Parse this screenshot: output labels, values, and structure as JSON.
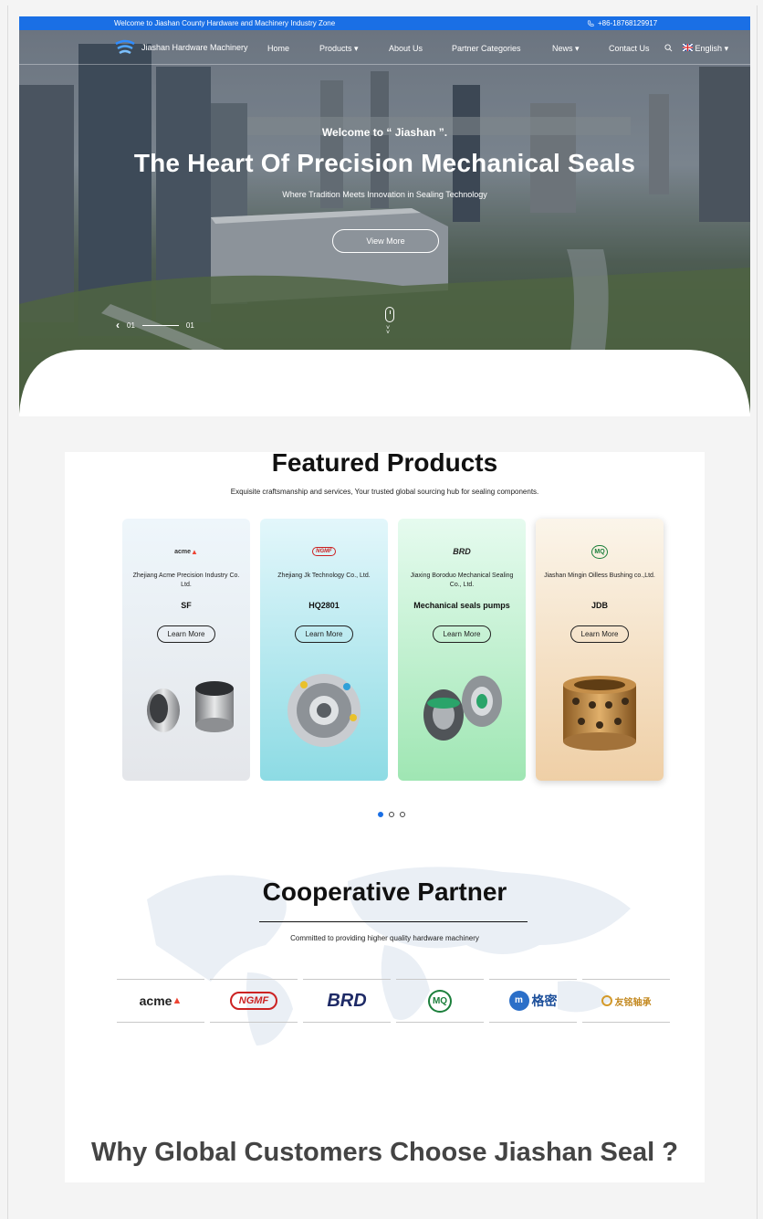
{
  "topbar": {
    "welcome": "Welcome to Jiashan County Hardware and Machinery Industry Zone",
    "phone": "+86-18768129917"
  },
  "nav": {
    "brand": "Jiashan Hardware Machinery",
    "items": [
      "Home",
      "Products",
      "About Us",
      "Partner Categories",
      "News",
      "Contact Us"
    ],
    "language": "English"
  },
  "hero": {
    "kicker": "Welcome to “ Jiashan ”.",
    "title": "The Heart Of Precision Mechanical Seals",
    "subtitle": "Where Tradition Meets Innovation in Sealing Technology",
    "button": "View More",
    "pager_current": "01",
    "pager_total": "01"
  },
  "featured": {
    "title": "Featured Products",
    "subtitle": "Exquisite craftsmanship and services, Your trusted global sourcing hub for sealing components.",
    "cards": [
      {
        "company": "Zhejiang Acme Precision Industry Co. Ltd.",
        "model": "SF",
        "button": "Learn More",
        "logo_text": "acme",
        "bg_top": "#eef6fb",
        "bg_bottom": "#e4e6ea"
      },
      {
        "company": "Zhejiang Jk Technology Co., Ltd.",
        "model": "HQ2801",
        "button": "Learn More",
        "logo_text": "NGMF",
        "bg_top": "#e3f7fb",
        "bg_bottom": "#8ddbe4"
      },
      {
        "company": "Jiaxing Boroduo Mechanical Sealing Co., Ltd.",
        "model": "Mechanical seals pumps",
        "button": "Learn More",
        "logo_text": "BRD",
        "bg_top": "#e6fbef",
        "bg_bottom": "#9fe6b3"
      },
      {
        "company": "Jiashan Mingin Oilless Bushing co.,Ltd.",
        "model": "JDB",
        "button": "Learn More",
        "logo_text": "MQ",
        "bg_top": "#fbf5ea",
        "bg_bottom": "#efcfa6"
      }
    ],
    "slides": 3,
    "active_slide": 0
  },
  "partners": {
    "title": "Cooperative Partner",
    "subtitle": "Committed to providing higher quality hardware machinery",
    "logos": [
      "acme",
      "NGMF",
      "BRD",
      "MQ",
      "格密",
      "友铭轴承"
    ]
  },
  "why": {
    "title": "Why Global Customers Choose Jiashan Seal ?"
  },
  "colors": {
    "accent": "#1a6fe5"
  }
}
